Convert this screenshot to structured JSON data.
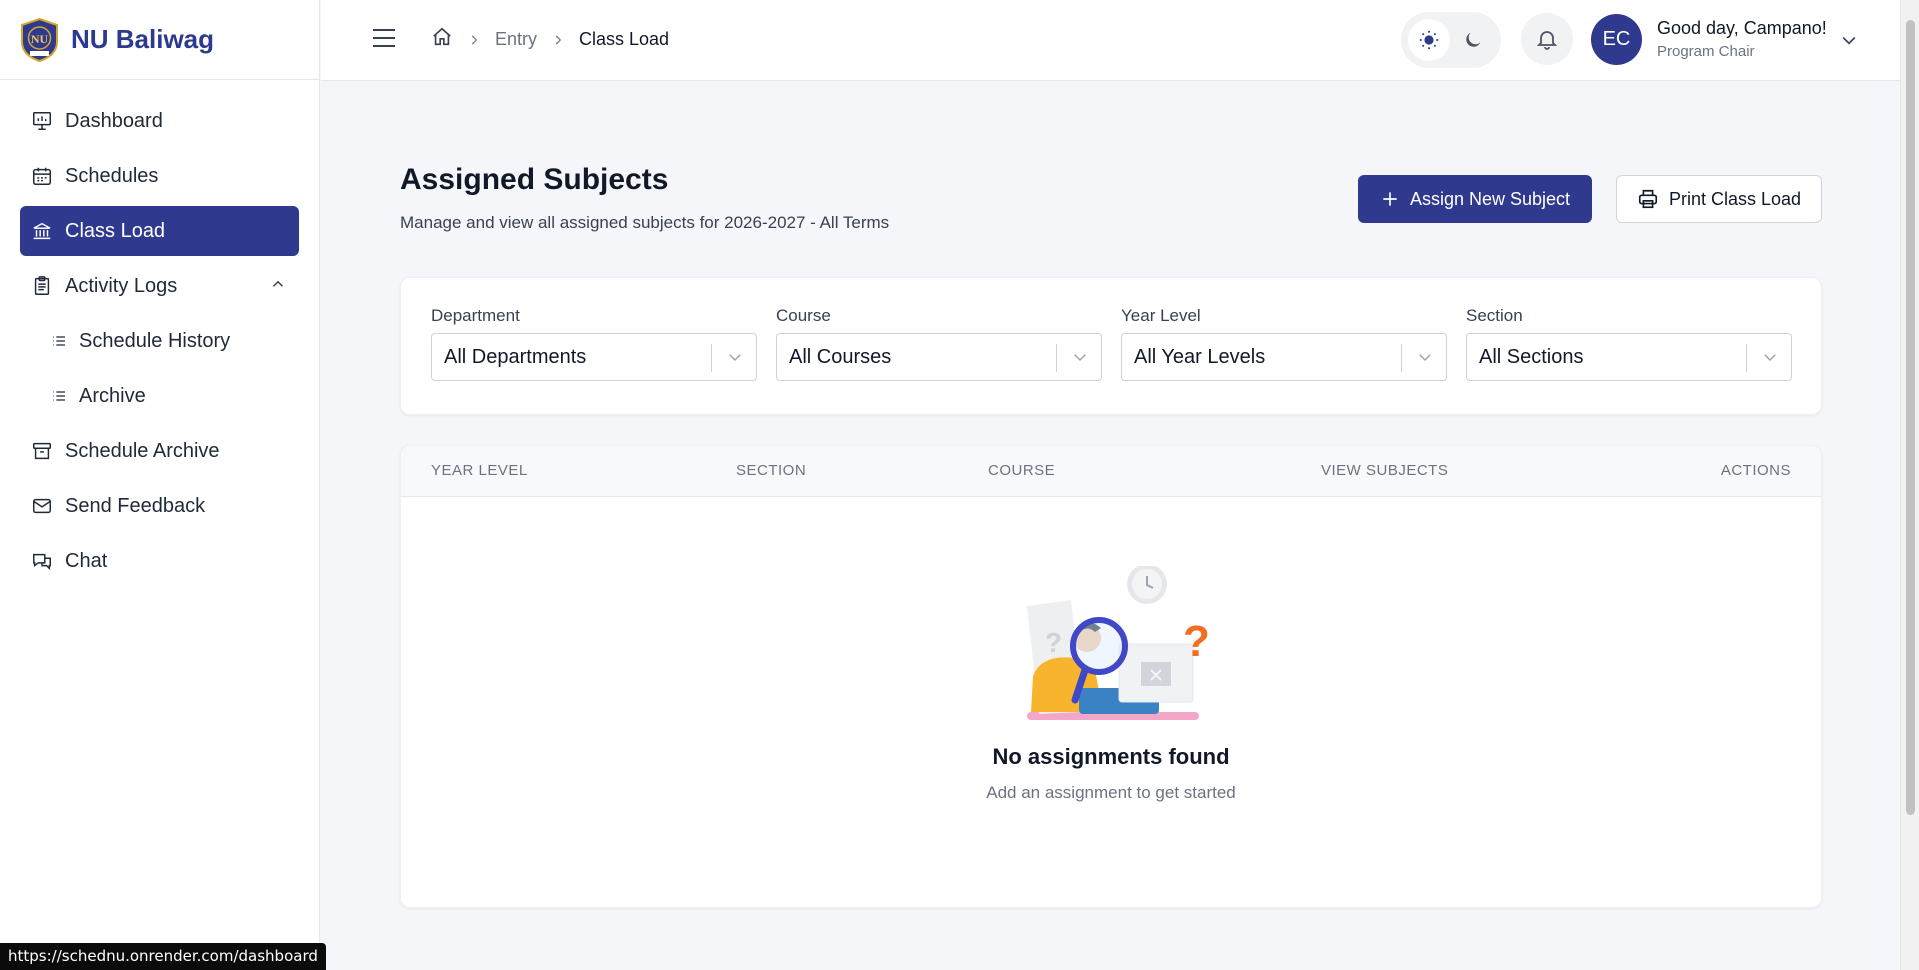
{
  "brand": {
    "name": "NU Baliwag"
  },
  "sidebar": {
    "items": [
      {
        "label": "Dashboard",
        "icon": "presentation-icon"
      },
      {
        "label": "Schedules",
        "icon": "calendar-icon"
      },
      {
        "label": "Class Load",
        "icon": "building-columns-icon",
        "active": true
      },
      {
        "label": "Activity Logs",
        "icon": "clipboard-icon",
        "expanded": true
      },
      {
        "label": "Schedule History",
        "icon": "list-icon",
        "sub": true
      },
      {
        "label": "Archive",
        "icon": "list-icon",
        "sub": true
      },
      {
        "label": "Schedule Archive",
        "icon": "archive-box-icon"
      },
      {
        "label": "Send Feedback",
        "icon": "mail-icon"
      },
      {
        "label": "Chat",
        "icon": "chat-bubbles-icon"
      }
    ]
  },
  "header": {
    "breadcrumb": [
      "Entry",
      "Class Load"
    ],
    "user": {
      "initials": "EC",
      "greeting": "Good day, Campano!",
      "role": "Program Chair"
    }
  },
  "page": {
    "title": "Assigned Subjects",
    "subtitle": "Manage and view all assigned subjects for 2026-2027 - All Terms",
    "assign_button": "Assign New Subject",
    "print_button": "Print Class Load"
  },
  "filters": [
    {
      "label": "Department",
      "value": "All Departments"
    },
    {
      "label": "Course",
      "value": "All Courses"
    },
    {
      "label": "Year Level",
      "value": "All Year Levels"
    },
    {
      "label": "Section",
      "value": "All Sections"
    }
  ],
  "table": {
    "columns": [
      "YEAR LEVEL",
      "SECTION",
      "COURSE",
      "VIEW SUBJECTS",
      "ACTIONS"
    ],
    "empty_title": "No assignments found",
    "empty_subtitle": "Add an assignment to get started"
  },
  "status_url": "https://schednu.onrender.com/dashboard",
  "colors": {
    "primary": "#2f3a8f",
    "background": "#f5f6fa"
  }
}
